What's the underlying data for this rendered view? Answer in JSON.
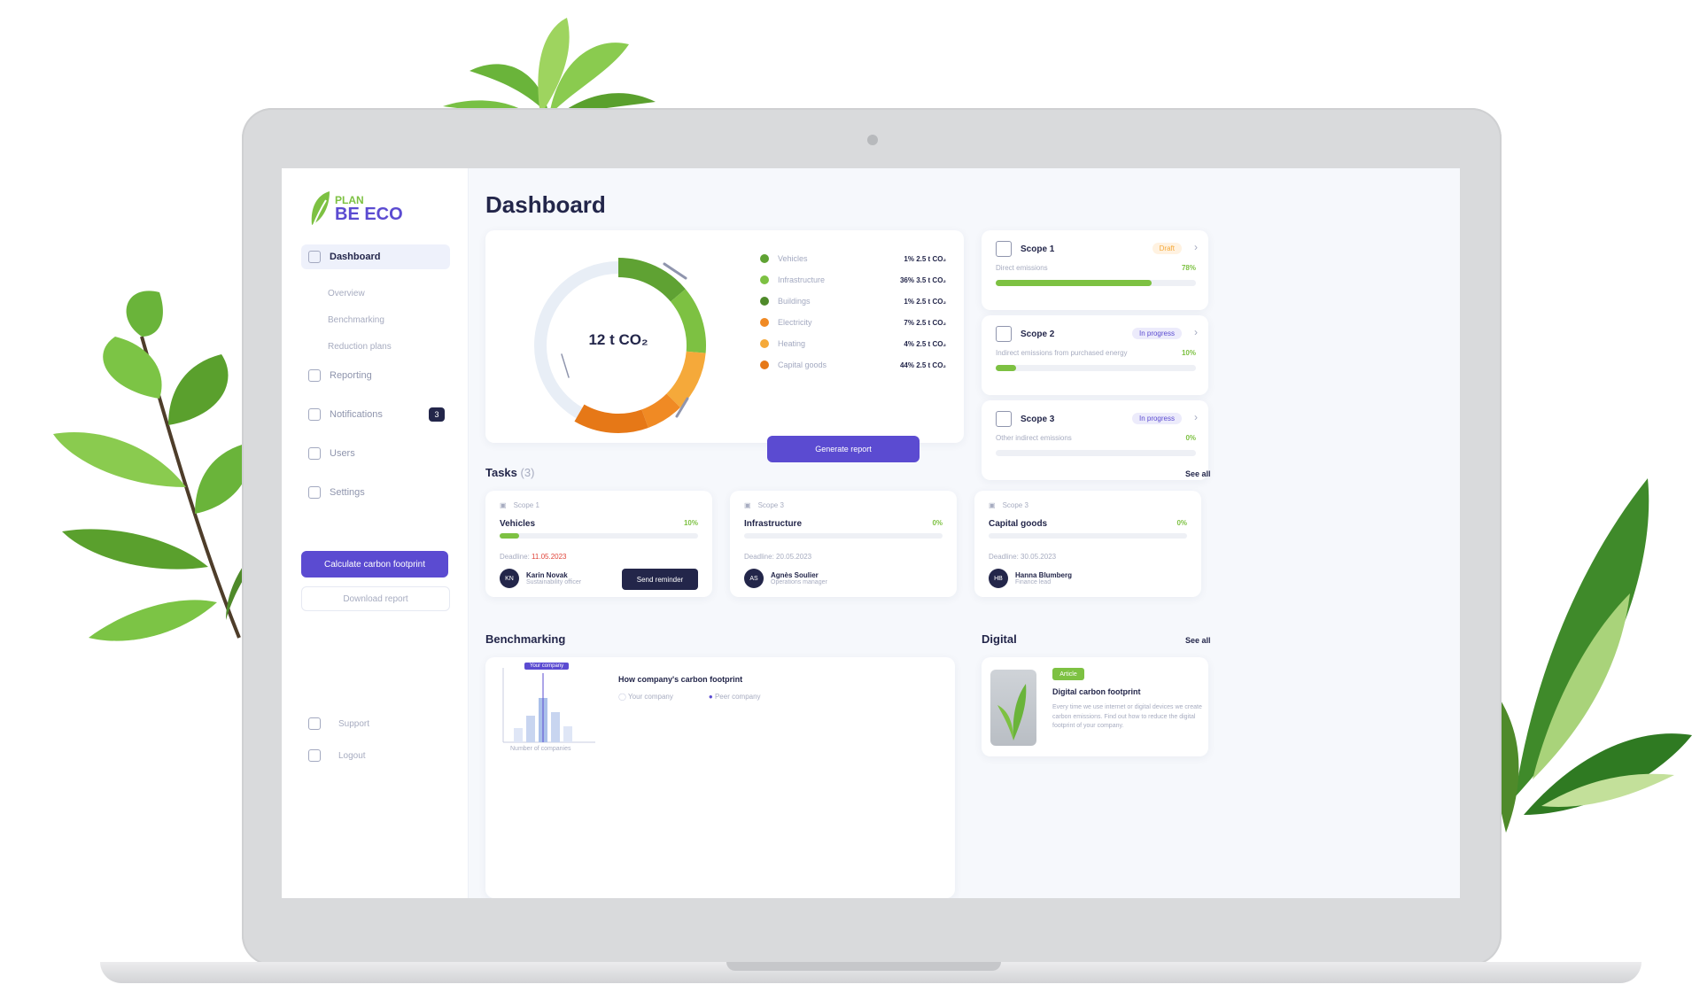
{
  "app": {
    "logo_top": "PLAN",
    "logo_bottom": "BE ECO"
  },
  "sidebar": {
    "items": [
      {
        "label": "Dashboard",
        "active": true,
        "icon": "dashboard-icon"
      },
      {
        "label": "Reporting",
        "icon": "report-icon"
      },
      {
        "label": "Notifications",
        "icon": "bell-icon",
        "badge": "3"
      },
      {
        "label": "Users",
        "icon": "users-icon"
      },
      {
        "label": "Settings",
        "icon": "gear-icon"
      }
    ],
    "sub_items": [
      "Overview",
      "Benchmarking",
      "Reduction plans"
    ],
    "cta_primary": "Calculate carbon footprint",
    "cta_secondary": "Download report",
    "footer": [
      {
        "label": "Support",
        "icon": "support-icon"
      },
      {
        "label": "Logout",
        "icon": "logout-icon"
      }
    ]
  },
  "main": {
    "title": "Dashboard",
    "donut": {
      "center_label": "12 t CO₂",
      "legend": [
        {
          "name": "Vehicles",
          "value": "1% 2.5 t CO₂",
          "color": "#5fa233"
        },
        {
          "name": "Infrastructure",
          "value": "36% 3.5 t CO₂",
          "color": "#7dc142"
        },
        {
          "name": "Buildings",
          "value": "1% 2.5 t CO₂",
          "color": "#4f8a2a"
        },
        {
          "name": "Electricity",
          "value": "7% 2.5 t CO₂",
          "color": "#f08a24"
        },
        {
          "name": "Heating",
          "value": "4% 2.5 t CO₂",
          "color": "#f5a93a"
        },
        {
          "name": "Capital goods",
          "value": "44% 2.5 t CO₂",
          "color": "#e67817"
        }
      ],
      "button": "Generate report"
    },
    "scopes": [
      {
        "name": "Scope 1",
        "tag": "Draft",
        "tag_color": "#f5a93a",
        "desc": "Direct emissions",
        "pct": "78%",
        "progress": 0.78
      },
      {
        "name": "Scope 2",
        "tag": "In progress",
        "tag_color": "#5b4bd1",
        "desc": "Indirect emissions from purchased energy",
        "pct": "10%",
        "progress": 0.1
      },
      {
        "name": "Scope 3",
        "tag": "In progress",
        "tag_color": "#5b4bd1",
        "desc": "Other indirect emissions",
        "pct": "0%",
        "progress": 0.0
      }
    ],
    "tasks_section": {
      "title": "Tasks",
      "count": "(3)",
      "see_all": "See all"
    },
    "tasks": [
      {
        "scope": "Scope 1",
        "title": "Vehicles",
        "pct": "10%",
        "progress": 0.1,
        "deadline_label": "Deadline:",
        "deadline": "11.05.2023",
        "late": true,
        "avatar": "KN",
        "person": "Karin Novak",
        "role": "Sustainability officer",
        "button": "Send reminder"
      },
      {
        "scope": "Scope 3",
        "title": "Infrastructure",
        "pct": "0%",
        "progress": 0.0,
        "deadline_label": "Deadline:",
        "deadline": "20.05.2023",
        "late": false,
        "avatar": "AS",
        "person": "Agnès Soulier",
        "role": "Operations manager",
        "button": ""
      },
      {
        "scope": "Scope 3",
        "title": "Capital goods",
        "pct": "0%",
        "progress": 0.0,
        "deadline_label": "Deadline:",
        "deadline": "30.05.2023",
        "late": false,
        "avatar": "HB",
        "person": "Hanna Blumberg",
        "role": "Finance lead",
        "button": ""
      }
    ],
    "benchmarking": {
      "title": "Benchmarking",
      "chart_caption": "Number of companies",
      "chart_badge": "Your company",
      "subtitle": "How company's carbon footprint",
      "legend": [
        "Your company",
        "Peer company"
      ]
    },
    "digital": {
      "title": "Digital",
      "see_all": "See all",
      "tag": "Article",
      "item_title": "Digital carbon footprint",
      "item_text": "Every time we use internet or digital devices we create carbon emissions. Find out how to reduce the digital footprint of your company."
    }
  }
}
